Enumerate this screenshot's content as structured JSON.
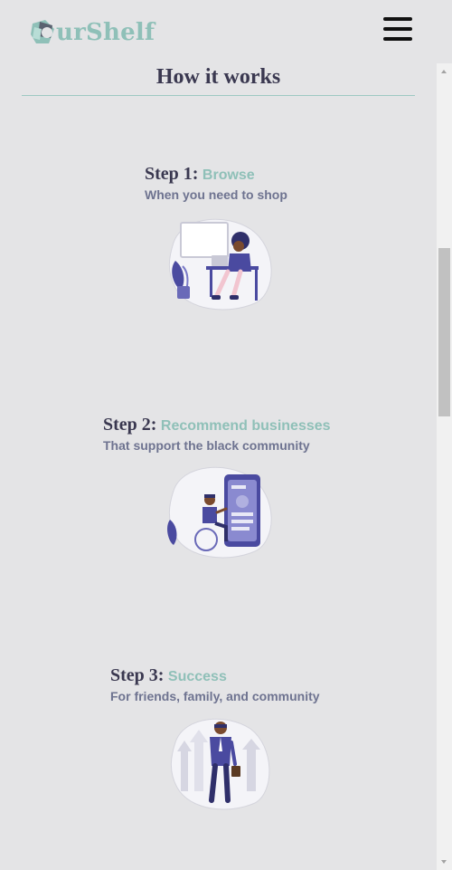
{
  "header": {
    "logo_text": "urShelf"
  },
  "section": {
    "title": "How it works"
  },
  "steps": [
    {
      "prefix": "Step 1:",
      "name": "Browse",
      "description": "When you need to shop",
      "illustration": "person-at-desk-illustration"
    },
    {
      "prefix": "Step 2:",
      "name": "Recommend businesses",
      "description": "That support the black community",
      "illustration": "person-in-wheelchair-with-phone-illustration"
    },
    {
      "prefix": "Step 3:",
      "name": "Success",
      "description": "For friends, family, and community",
      "illustration": "businessman-with-arrows-illustration"
    }
  ],
  "colors": {
    "background": "#e4e4e6",
    "accent": "#8fc0b8",
    "heading": "#3a3850",
    "subtext": "#6e7390",
    "illustration_primary": "#4a4aa0"
  }
}
